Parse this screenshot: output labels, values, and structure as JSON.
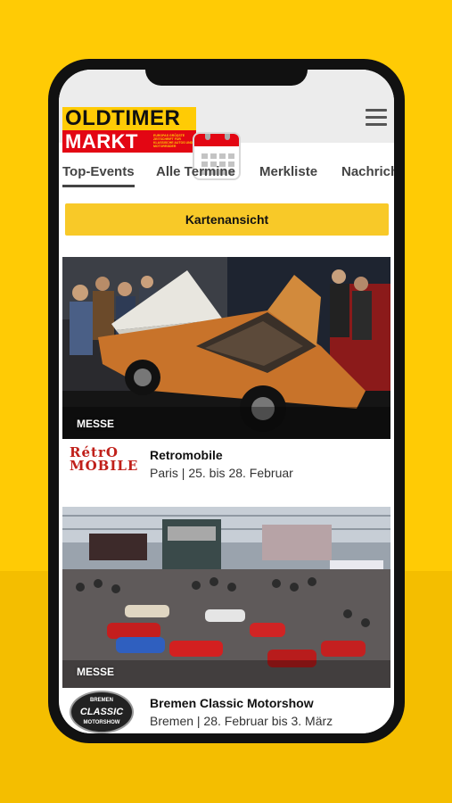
{
  "app": {
    "logo_line1": "OLDTIMER",
    "logo_line2": "MARKT",
    "logo_tagline": "EUROPAS GRÖSSTE ZEITSCHRIFT FÜR KLASSISCHE AUTOS UND MOTORRÄDER"
  },
  "tabs": [
    {
      "label": "Top-Events",
      "active": true
    },
    {
      "label": "Alle Termine",
      "active": false
    },
    {
      "label": "Merkliste",
      "active": false
    },
    {
      "label": "Nachrich",
      "active": false
    }
  ],
  "map_button_label": "Kartenansicht",
  "events": [
    {
      "badge": "MESSE",
      "title": "Retromobile",
      "subtitle": "Paris | 25. bis 28. Februar",
      "logo_text_line1": "RétrO",
      "logo_text_line2": "MOBILE"
    },
    {
      "badge": "MESSE",
      "title": "Bremen Classic Motorshow",
      "subtitle": "Bremen | 28. Februar bis 3. März",
      "logo_text_top": "BREMEN",
      "logo_text_mid": "CLASSIC",
      "logo_text_bottom": "MOTORSHOW"
    }
  ],
  "colors": {
    "background": "#FFCB05",
    "accent_red": "#E30613",
    "button_yellow": "#F8C928"
  },
  "icons": {
    "menu": "hamburger-menu-icon",
    "calendar": "calendar-icon"
  }
}
